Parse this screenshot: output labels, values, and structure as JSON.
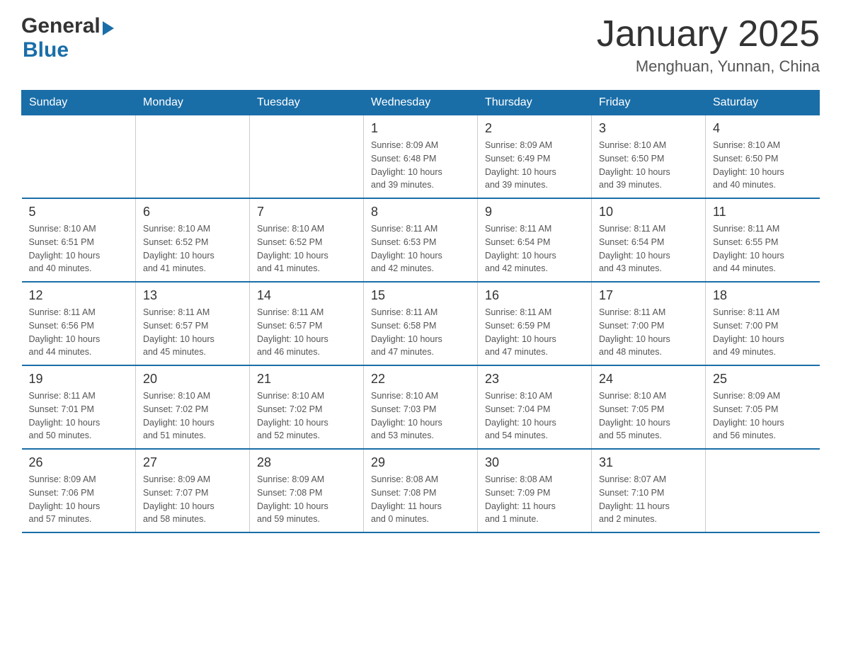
{
  "header": {
    "logo": {
      "general": "General",
      "arrow": "▶",
      "blue": "Blue"
    },
    "title": "January 2025",
    "location": "Menghuan, Yunnan, China"
  },
  "days_of_week": [
    "Sunday",
    "Monday",
    "Tuesday",
    "Wednesday",
    "Thursday",
    "Friday",
    "Saturday"
  ],
  "weeks": [
    [
      {
        "day": "",
        "info": ""
      },
      {
        "day": "",
        "info": ""
      },
      {
        "day": "",
        "info": ""
      },
      {
        "day": "1",
        "info": "Sunrise: 8:09 AM\nSunset: 6:48 PM\nDaylight: 10 hours\nand 39 minutes."
      },
      {
        "day": "2",
        "info": "Sunrise: 8:09 AM\nSunset: 6:49 PM\nDaylight: 10 hours\nand 39 minutes."
      },
      {
        "day": "3",
        "info": "Sunrise: 8:10 AM\nSunset: 6:50 PM\nDaylight: 10 hours\nand 39 minutes."
      },
      {
        "day": "4",
        "info": "Sunrise: 8:10 AM\nSunset: 6:50 PM\nDaylight: 10 hours\nand 40 minutes."
      }
    ],
    [
      {
        "day": "5",
        "info": "Sunrise: 8:10 AM\nSunset: 6:51 PM\nDaylight: 10 hours\nand 40 minutes."
      },
      {
        "day": "6",
        "info": "Sunrise: 8:10 AM\nSunset: 6:52 PM\nDaylight: 10 hours\nand 41 minutes."
      },
      {
        "day": "7",
        "info": "Sunrise: 8:10 AM\nSunset: 6:52 PM\nDaylight: 10 hours\nand 41 minutes."
      },
      {
        "day": "8",
        "info": "Sunrise: 8:11 AM\nSunset: 6:53 PM\nDaylight: 10 hours\nand 42 minutes."
      },
      {
        "day": "9",
        "info": "Sunrise: 8:11 AM\nSunset: 6:54 PM\nDaylight: 10 hours\nand 42 minutes."
      },
      {
        "day": "10",
        "info": "Sunrise: 8:11 AM\nSunset: 6:54 PM\nDaylight: 10 hours\nand 43 minutes."
      },
      {
        "day": "11",
        "info": "Sunrise: 8:11 AM\nSunset: 6:55 PM\nDaylight: 10 hours\nand 44 minutes."
      }
    ],
    [
      {
        "day": "12",
        "info": "Sunrise: 8:11 AM\nSunset: 6:56 PM\nDaylight: 10 hours\nand 44 minutes."
      },
      {
        "day": "13",
        "info": "Sunrise: 8:11 AM\nSunset: 6:57 PM\nDaylight: 10 hours\nand 45 minutes."
      },
      {
        "day": "14",
        "info": "Sunrise: 8:11 AM\nSunset: 6:57 PM\nDaylight: 10 hours\nand 46 minutes."
      },
      {
        "day": "15",
        "info": "Sunrise: 8:11 AM\nSunset: 6:58 PM\nDaylight: 10 hours\nand 47 minutes."
      },
      {
        "day": "16",
        "info": "Sunrise: 8:11 AM\nSunset: 6:59 PM\nDaylight: 10 hours\nand 47 minutes."
      },
      {
        "day": "17",
        "info": "Sunrise: 8:11 AM\nSunset: 7:00 PM\nDaylight: 10 hours\nand 48 minutes."
      },
      {
        "day": "18",
        "info": "Sunrise: 8:11 AM\nSunset: 7:00 PM\nDaylight: 10 hours\nand 49 minutes."
      }
    ],
    [
      {
        "day": "19",
        "info": "Sunrise: 8:11 AM\nSunset: 7:01 PM\nDaylight: 10 hours\nand 50 minutes."
      },
      {
        "day": "20",
        "info": "Sunrise: 8:10 AM\nSunset: 7:02 PM\nDaylight: 10 hours\nand 51 minutes."
      },
      {
        "day": "21",
        "info": "Sunrise: 8:10 AM\nSunset: 7:02 PM\nDaylight: 10 hours\nand 52 minutes."
      },
      {
        "day": "22",
        "info": "Sunrise: 8:10 AM\nSunset: 7:03 PM\nDaylight: 10 hours\nand 53 minutes."
      },
      {
        "day": "23",
        "info": "Sunrise: 8:10 AM\nSunset: 7:04 PM\nDaylight: 10 hours\nand 54 minutes."
      },
      {
        "day": "24",
        "info": "Sunrise: 8:10 AM\nSunset: 7:05 PM\nDaylight: 10 hours\nand 55 minutes."
      },
      {
        "day": "25",
        "info": "Sunrise: 8:09 AM\nSunset: 7:05 PM\nDaylight: 10 hours\nand 56 minutes."
      }
    ],
    [
      {
        "day": "26",
        "info": "Sunrise: 8:09 AM\nSunset: 7:06 PM\nDaylight: 10 hours\nand 57 minutes."
      },
      {
        "day": "27",
        "info": "Sunrise: 8:09 AM\nSunset: 7:07 PM\nDaylight: 10 hours\nand 58 minutes."
      },
      {
        "day": "28",
        "info": "Sunrise: 8:09 AM\nSunset: 7:08 PM\nDaylight: 10 hours\nand 59 minutes."
      },
      {
        "day": "29",
        "info": "Sunrise: 8:08 AM\nSunset: 7:08 PM\nDaylight: 11 hours\nand 0 minutes."
      },
      {
        "day": "30",
        "info": "Sunrise: 8:08 AM\nSunset: 7:09 PM\nDaylight: 11 hours\nand 1 minute."
      },
      {
        "day": "31",
        "info": "Sunrise: 8:07 AM\nSunset: 7:10 PM\nDaylight: 11 hours\nand 2 minutes."
      },
      {
        "day": "",
        "info": ""
      }
    ]
  ]
}
